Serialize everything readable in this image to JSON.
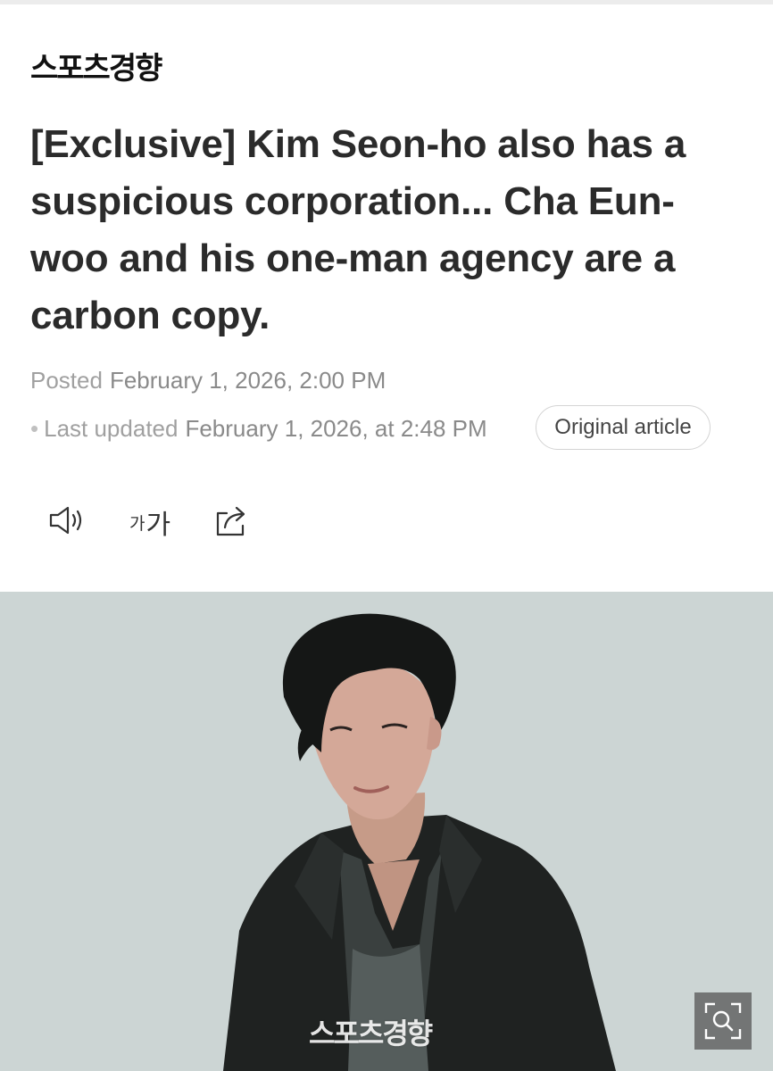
{
  "publisher": {
    "logo_text": "스포츠경향"
  },
  "article": {
    "headline": "[Exclusive] Kim Seon-ho also has a suspicious corporation... Cha Eun-woo and his one-man agency are a carbon copy.",
    "posted_label": "Posted",
    "posted_value": "February 1, 2026, 2:00 PM",
    "updated_bullet": "•",
    "updated_label": "Last updated",
    "updated_value": "February 1, 2026, at 2:48 PM",
    "original_button": "Original article"
  },
  "toolbar": {
    "speaker_icon": "speaker-icon",
    "font_small": "가",
    "font_large": "가",
    "share_icon": "share-icon"
  },
  "photo": {
    "watermark_text": "스포츠경향",
    "zoom_icon": "zoom-icon",
    "background_color": "#cdd6d5"
  }
}
